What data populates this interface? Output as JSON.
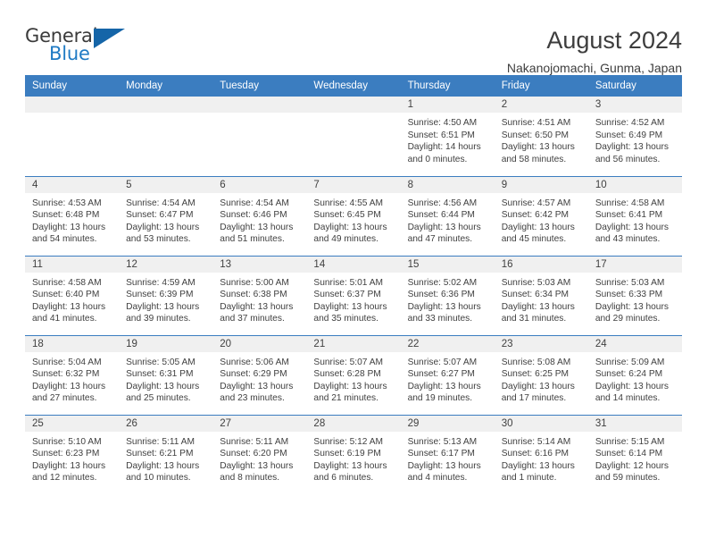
{
  "logo": {
    "general_text": "General",
    "blue_text": "Blue"
  },
  "header": {
    "title": "August 2024",
    "subtitle": "Nakanojomachi, Gunma, Japan"
  },
  "colors": {
    "header_blue": "#3b7dc0",
    "logo_blue": "#1f7ac4",
    "daynum_band": "#f0f0f0",
    "text": "#404040"
  },
  "weekdays": [
    "Sunday",
    "Monday",
    "Tuesday",
    "Wednesday",
    "Thursday",
    "Friday",
    "Saturday"
  ],
  "labels": {
    "sunrise_prefix": "Sunrise:",
    "sunset_prefix": "Sunset:",
    "daylight_prefix": "Daylight:"
  },
  "weeks": [
    [
      {
        "day": "",
        "empty": true
      },
      {
        "day": "",
        "empty": true
      },
      {
        "day": "",
        "empty": true
      },
      {
        "day": "",
        "empty": true
      },
      {
        "day": "1",
        "sunrise": "Sunrise: 4:50 AM",
        "sunset": "Sunset: 6:51 PM",
        "daylight1": "Daylight: 14 hours",
        "daylight2": "and 0 minutes."
      },
      {
        "day": "2",
        "sunrise": "Sunrise: 4:51 AM",
        "sunset": "Sunset: 6:50 PM",
        "daylight1": "Daylight: 13 hours",
        "daylight2": "and 58 minutes."
      },
      {
        "day": "3",
        "sunrise": "Sunrise: 4:52 AM",
        "sunset": "Sunset: 6:49 PM",
        "daylight1": "Daylight: 13 hours",
        "daylight2": "and 56 minutes."
      }
    ],
    [
      {
        "day": "4",
        "sunrise": "Sunrise: 4:53 AM",
        "sunset": "Sunset: 6:48 PM",
        "daylight1": "Daylight: 13 hours",
        "daylight2": "and 54 minutes."
      },
      {
        "day": "5",
        "sunrise": "Sunrise: 4:54 AM",
        "sunset": "Sunset: 6:47 PM",
        "daylight1": "Daylight: 13 hours",
        "daylight2": "and 53 minutes."
      },
      {
        "day": "6",
        "sunrise": "Sunrise: 4:54 AM",
        "sunset": "Sunset: 6:46 PM",
        "daylight1": "Daylight: 13 hours",
        "daylight2": "and 51 minutes."
      },
      {
        "day": "7",
        "sunrise": "Sunrise: 4:55 AM",
        "sunset": "Sunset: 6:45 PM",
        "daylight1": "Daylight: 13 hours",
        "daylight2": "and 49 minutes."
      },
      {
        "day": "8",
        "sunrise": "Sunrise: 4:56 AM",
        "sunset": "Sunset: 6:44 PM",
        "daylight1": "Daylight: 13 hours",
        "daylight2": "and 47 minutes."
      },
      {
        "day": "9",
        "sunrise": "Sunrise: 4:57 AM",
        "sunset": "Sunset: 6:42 PM",
        "daylight1": "Daylight: 13 hours",
        "daylight2": "and 45 minutes."
      },
      {
        "day": "10",
        "sunrise": "Sunrise: 4:58 AM",
        "sunset": "Sunset: 6:41 PM",
        "daylight1": "Daylight: 13 hours",
        "daylight2": "and 43 minutes."
      }
    ],
    [
      {
        "day": "11",
        "sunrise": "Sunrise: 4:58 AM",
        "sunset": "Sunset: 6:40 PM",
        "daylight1": "Daylight: 13 hours",
        "daylight2": "and 41 minutes."
      },
      {
        "day": "12",
        "sunrise": "Sunrise: 4:59 AM",
        "sunset": "Sunset: 6:39 PM",
        "daylight1": "Daylight: 13 hours",
        "daylight2": "and 39 minutes."
      },
      {
        "day": "13",
        "sunrise": "Sunrise: 5:00 AM",
        "sunset": "Sunset: 6:38 PM",
        "daylight1": "Daylight: 13 hours",
        "daylight2": "and 37 minutes."
      },
      {
        "day": "14",
        "sunrise": "Sunrise: 5:01 AM",
        "sunset": "Sunset: 6:37 PM",
        "daylight1": "Daylight: 13 hours",
        "daylight2": "and 35 minutes."
      },
      {
        "day": "15",
        "sunrise": "Sunrise: 5:02 AM",
        "sunset": "Sunset: 6:36 PM",
        "daylight1": "Daylight: 13 hours",
        "daylight2": "and 33 minutes."
      },
      {
        "day": "16",
        "sunrise": "Sunrise: 5:03 AM",
        "sunset": "Sunset: 6:34 PM",
        "daylight1": "Daylight: 13 hours",
        "daylight2": "and 31 minutes."
      },
      {
        "day": "17",
        "sunrise": "Sunrise: 5:03 AM",
        "sunset": "Sunset: 6:33 PM",
        "daylight1": "Daylight: 13 hours",
        "daylight2": "and 29 minutes."
      }
    ],
    [
      {
        "day": "18",
        "sunrise": "Sunrise: 5:04 AM",
        "sunset": "Sunset: 6:32 PM",
        "daylight1": "Daylight: 13 hours",
        "daylight2": "and 27 minutes."
      },
      {
        "day": "19",
        "sunrise": "Sunrise: 5:05 AM",
        "sunset": "Sunset: 6:31 PM",
        "daylight1": "Daylight: 13 hours",
        "daylight2": "and 25 minutes."
      },
      {
        "day": "20",
        "sunrise": "Sunrise: 5:06 AM",
        "sunset": "Sunset: 6:29 PM",
        "daylight1": "Daylight: 13 hours",
        "daylight2": "and 23 minutes."
      },
      {
        "day": "21",
        "sunrise": "Sunrise: 5:07 AM",
        "sunset": "Sunset: 6:28 PM",
        "daylight1": "Daylight: 13 hours",
        "daylight2": "and 21 minutes."
      },
      {
        "day": "22",
        "sunrise": "Sunrise: 5:07 AM",
        "sunset": "Sunset: 6:27 PM",
        "daylight1": "Daylight: 13 hours",
        "daylight2": "and 19 minutes."
      },
      {
        "day": "23",
        "sunrise": "Sunrise: 5:08 AM",
        "sunset": "Sunset: 6:25 PM",
        "daylight1": "Daylight: 13 hours",
        "daylight2": "and 17 minutes."
      },
      {
        "day": "24",
        "sunrise": "Sunrise: 5:09 AM",
        "sunset": "Sunset: 6:24 PM",
        "daylight1": "Daylight: 13 hours",
        "daylight2": "and 14 minutes."
      }
    ],
    [
      {
        "day": "25",
        "sunrise": "Sunrise: 5:10 AM",
        "sunset": "Sunset: 6:23 PM",
        "daylight1": "Daylight: 13 hours",
        "daylight2": "and 12 minutes."
      },
      {
        "day": "26",
        "sunrise": "Sunrise: 5:11 AM",
        "sunset": "Sunset: 6:21 PM",
        "daylight1": "Daylight: 13 hours",
        "daylight2": "and 10 minutes."
      },
      {
        "day": "27",
        "sunrise": "Sunrise: 5:11 AM",
        "sunset": "Sunset: 6:20 PM",
        "daylight1": "Daylight: 13 hours",
        "daylight2": "and 8 minutes."
      },
      {
        "day": "28",
        "sunrise": "Sunrise: 5:12 AM",
        "sunset": "Sunset: 6:19 PM",
        "daylight1": "Daylight: 13 hours",
        "daylight2": "and 6 minutes."
      },
      {
        "day": "29",
        "sunrise": "Sunrise: 5:13 AM",
        "sunset": "Sunset: 6:17 PM",
        "daylight1": "Daylight: 13 hours",
        "daylight2": "and 4 minutes."
      },
      {
        "day": "30",
        "sunrise": "Sunrise: 5:14 AM",
        "sunset": "Sunset: 6:16 PM",
        "daylight1": "Daylight: 13 hours",
        "daylight2": "and 1 minute."
      },
      {
        "day": "31",
        "sunrise": "Sunrise: 5:15 AM",
        "sunset": "Sunset: 6:14 PM",
        "daylight1": "Daylight: 12 hours",
        "daylight2": "and 59 minutes."
      }
    ]
  ]
}
